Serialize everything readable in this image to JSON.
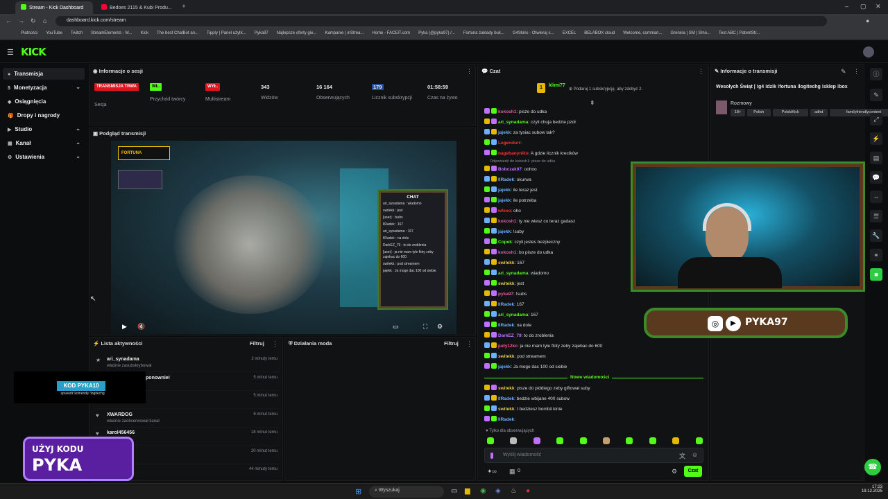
{
  "browser": {
    "tabs": [
      {
        "label": "Stream - Kick Dashboard",
        "active": true
      },
      {
        "label": "Bedoes 2115 & Kubi Produ...",
        "active": false
      }
    ],
    "url": "dashboard.kick.com/stream",
    "bookmarks": [
      "Płatności",
      "YouTube",
      "Twitch",
      "StreamElements - M...",
      "Kick",
      "The best ChatBot an...",
      "Tipply | Panel użytk...",
      "Pyka97",
      "Najlepsze oferty gie...",
      "Kampanie | inStrea...",
      "Home - FACEIT.com",
      "Pyka (@pyka97) /...",
      "Fortuna zakłady buk...",
      "G4Skins - Otwieraj s...",
      "EXCEL",
      "BELABOX cloud",
      "Welcome, comman...",
      "Grenina | SM | Smo...",
      "Test ABC | PatentStr..."
    ]
  },
  "kick": {
    "logo": "KICK"
  },
  "sidebar": {
    "items": [
      {
        "label": "Transmisja",
        "active": true,
        "chevron": false
      },
      {
        "label": "Monetyzacja",
        "chevron": true
      },
      {
        "label": "Osiągnięcia",
        "chevron": false
      },
      {
        "label": "Dropy i nagrody",
        "chevron": false
      },
      {
        "label": "Studio",
        "chevron": true
      },
      {
        "label": "Kanał",
        "chevron": true
      },
      {
        "label": "Ustawienia",
        "chevron": true
      }
    ]
  },
  "session": {
    "title": "Informacje o sesji",
    "stats": [
      {
        "badge": "TRANSMISJA TRWA",
        "label": "Sesja",
        "badge_color": "#e0141e"
      },
      {
        "badge": "WŁ.",
        "label": "Przychód twórcy",
        "badge_color": "#53fc18"
      },
      {
        "badge": "WYŁ.",
        "label": "Multistream",
        "badge_color": "#e0141e"
      },
      {
        "value": "343",
        "label": "Widzów"
      },
      {
        "value": "16 164",
        "label": "Obserwujących"
      },
      {
        "value": "179",
        "label": "Licznik subskrypcji"
      },
      {
        "value": "01:58:59",
        "label": "Czas na żywo"
      }
    ]
  },
  "preview": {
    "title": "Podgląd transmisji",
    "chat_overlay_title": "CHAT",
    "chat_overlay_lines": [
      "ari_synadama : wiadomo",
      "switekk : jest",
      "[user] : !subs",
      "llRadek : 167",
      "ari_synadama : 167",
      "llRadek : na dole",
      "DarkEZ_79 : to do zroblenia",
      "[user] : ja nie mam tyle floty zeby zajebac do 600",
      "switekk : pod streamem",
      "jajekk : Ja moge dac 100 od siebie"
    ]
  },
  "activity": {
    "title": "Lista aktywności",
    "filter": "Filtruj",
    "items": [
      {
        "name": "ari_synadama",
        "desc": "właśnie zasubskrybował",
        "time": "2 minuty temu",
        "icon": "★"
      },
      {
        "name": "zasubskrybował ponownie!",
        "desc": "owali na 2 miesiące",
        "time": "5 minut temu",
        "icon": "★"
      },
      {
        "name": "",
        "desc": "wał kanał",
        "time": "5 minut temu",
        "icon": "♥"
      },
      {
        "name": "XWARDOG",
        "desc": "właśnie zaobserwował kanał",
        "time": "8 minut temu",
        "icon": "♥"
      },
      {
        "name": "karol456456",
        "desc": "wał kanał",
        "time": "18 minut temu",
        "icon": "♥"
      },
      {
        "name": "",
        "desc": "wał kanał",
        "time": "20 minut temu",
        "icon": "♥"
      },
      {
        "name": "",
        "desc": "wował kanał",
        "time": "44 minuty temu",
        "icon": "♥"
      }
    ]
  },
  "modactions": {
    "title": "Działania moda",
    "filter": "Filtruj"
  },
  "chat": {
    "title": "Czat",
    "top_user": "klimi77",
    "top_user_count": "1",
    "gift_text": "Podaruj 1 subskrypcję, aby zdobyć 2.",
    "messages": [
      {
        "user": "kokosh1",
        "text": ": pisze do udka",
        "color": "#e05aa0"
      },
      {
        "user": "ari_synadama",
        "text": ": czyli chuja bedzie pzdr",
        "color": "#53fc18"
      },
      {
        "user": "jajekk",
        "text": ": za tysiac subow tak?",
        "color": "#6ab0ff"
      },
      {
        "user": "Legendurr",
        "text": ": ",
        "color": "#ff3030"
      },
      {
        "user": "nagebanyniko",
        "text": ": A gdzie licznik krecików",
        "color": "#ff3030"
      },
      {
        "user": "Bobczak97",
        "text": ": oohoo",
        "color": "#c070ff",
        "reply": "Odpowiedź do kokosh1: pisze do udka"
      },
      {
        "user": "llRadek",
        "text": ": okurwa",
        "color": "#6ab0ff"
      },
      {
        "user": "jajekk",
        "text": ": ile teraz jest",
        "color": "#6ab0ff"
      },
      {
        "user": "jajekk",
        "text": ": ile potrzeba",
        "color": "#6ab0ff"
      },
      {
        "user": "wfexo",
        "text": ": oho",
        "color": "#ff3030"
      },
      {
        "user": "kokosh1",
        "text": ": ty nie wiesz co teraz gadasz",
        "color": "#e05aa0"
      },
      {
        "user": "jajekk",
        "text": ": !suby",
        "color": "#6ab0ff"
      },
      {
        "user": "Copek",
        "text": ": czyli jestes bezpieczny",
        "color": "#53fc18"
      },
      {
        "user": "kokosh1",
        "text": ": bo pisze do udka",
        "color": "#e05aa0"
      },
      {
        "user": "switekk",
        "text": ": 167",
        "color": "#e6c84a"
      },
      {
        "user": "ari_synadama",
        "text": ": wiadomo",
        "color": "#53fc18"
      },
      {
        "user": "switekk",
        "text": ": jest",
        "color": "#e6c84a"
      },
      {
        "user": "pyka97",
        "text": ": !subs",
        "color": "#e05aa0"
      },
      {
        "user": "llRadek",
        "text": ": 167",
        "color": "#6ab0ff"
      },
      {
        "user": "ari_synadama",
        "text": ": 167",
        "color": "#53fc18"
      },
      {
        "user": "llRadek",
        "text": ": na dole",
        "color": "#6ab0ff"
      },
      {
        "user": "DarkEZ_79",
        "text": ": to do zroblenia",
        "color": "#c070ff"
      },
      {
        "user": "judy12kc",
        "text": ": ja nie mam tyle floty zeby zajebac do 600",
        "color": "#ff5090"
      },
      {
        "user": "switekk",
        "text": ": pod streamem",
        "color": "#e6c84a"
      },
      {
        "user": "jajekk",
        "text": ": Ja moge dac 100 od siebie",
        "color": "#6ab0ff"
      }
    ],
    "new_messages_label": "Nowe wiadomości",
    "new_messages": [
      {
        "user": "switekk",
        "text": ": pisze do piddiego zeby giftował suby",
        "color": "#e6c84a"
      },
      {
        "user": "llRadek",
        "text": ": bedzie wbijane 400 subow",
        "color": "#6ab0ff"
      },
      {
        "user": "switekk",
        "text": ": I bedziesz bombil kinie",
        "color": "#e6c84a"
      },
      {
        "user": "llRadek",
        "text": ": ",
        "color": "#6ab0ff"
      }
    ],
    "followers_only": "Tylko dla obserwujących",
    "input_placeholder": "Wyślij wiadomość",
    "points": "0",
    "send_label": "Czat"
  },
  "stream_info": {
    "title": "Informacje o transmisji",
    "stream_title": "Wesołych Świąt | !g4 !dzik !fortuna !logitechg !sklep !box",
    "category": "Rozmowy",
    "tags": [
      "18+",
      "Polish",
      "PolskiKick",
      "adhd",
      "familyfriendlycontent"
    ]
  },
  "overlays": {
    "social_handle": "PYKA97",
    "code_box_title": "KOD PYKA10",
    "code_box_sub": "sprawdź komendę !logitechg",
    "promo_line1": "UŻYJ KODU",
    "promo_line2": "PYKA",
    "fortuna": "FORTUNA"
  },
  "taskbar": {
    "search_placeholder": "Wyszukaj",
    "time": "17:23",
    "date": "19.12.2025"
  }
}
